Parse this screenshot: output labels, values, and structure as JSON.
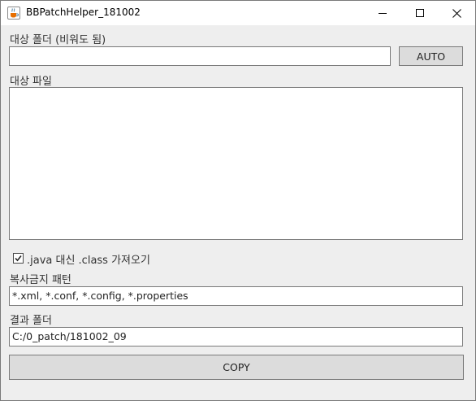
{
  "window": {
    "title": "BBPatchHelper_181002",
    "icon": "java-cup-icon",
    "controls": [
      "minimize-icon",
      "maximize-icon",
      "close-icon"
    ]
  },
  "target_folder": {
    "label": "대상 폴더 (비워도 됨)",
    "value": "",
    "auto_button": "AUTO"
  },
  "target_files": {
    "label": "대상 파일",
    "value": ""
  },
  "class_option": {
    "checked": true,
    "label": ".java 대신 .class 가져오기"
  },
  "exclude_pattern": {
    "label": "복사금지 패턴",
    "value": "*.xml, *.conf, *.config, *.properties"
  },
  "result_folder": {
    "label": "결과 폴더",
    "value": "C:/0_patch/181002_09"
  },
  "copy_button": "COPY",
  "colors": {
    "window_bg": "#eeeeee",
    "button_bg": "#dcdcdc",
    "border": "#7a7a7a"
  }
}
